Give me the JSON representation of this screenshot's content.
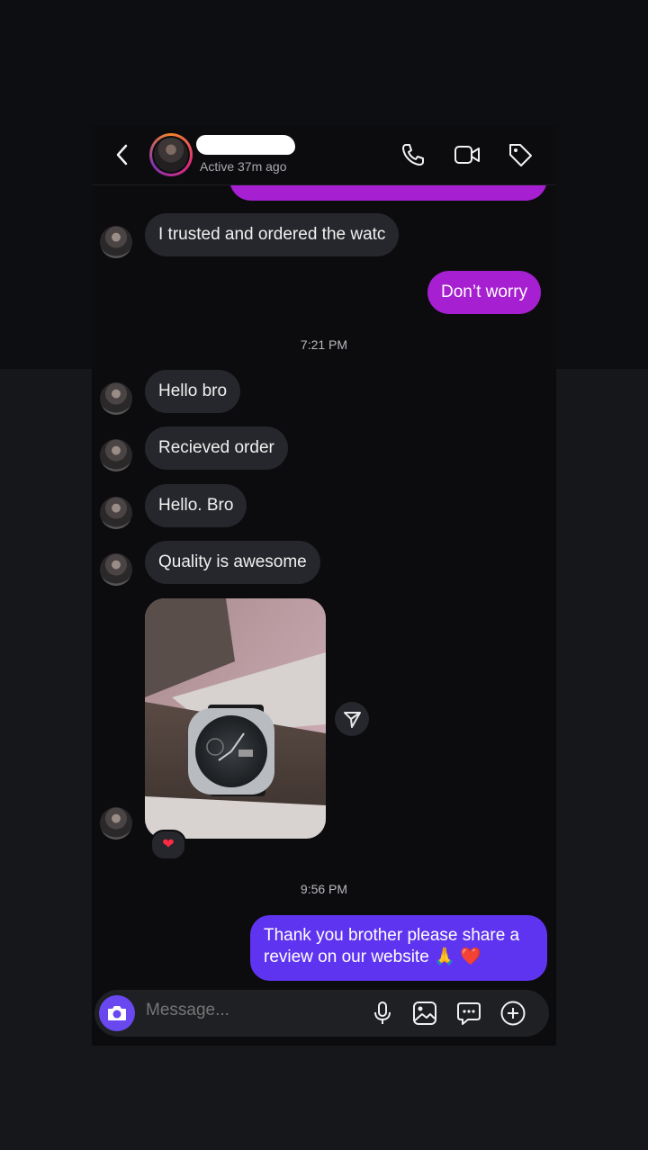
{
  "header": {
    "status": "Active 37m ago",
    "icons": [
      "back-icon",
      "phone-icon",
      "video-icon",
      "tag-icon"
    ]
  },
  "messages": {
    "trusted": "I trusted and ordered the watc",
    "dont_worry": "Don’t worry",
    "time_1": "7:21 PM",
    "hello_bro": "Hello bro",
    "received": "Recieved order",
    "hello_bro2": "Hello. Bro",
    "quality": "Quality is awesome",
    "reaction": "❤",
    "time_2": "9:56 PM",
    "thank_you_line1": "Thank you brother please share a",
    "thank_you_line2": "review on our website 🙏 ❤️"
  },
  "composer": {
    "placeholder": "Message..."
  },
  "colors": {
    "incoming_bubble": "#26272c",
    "outgoing_purple": "#a61fd0",
    "outgoing_violet": "#5f34f0",
    "camera_button": "#6948f0"
  }
}
